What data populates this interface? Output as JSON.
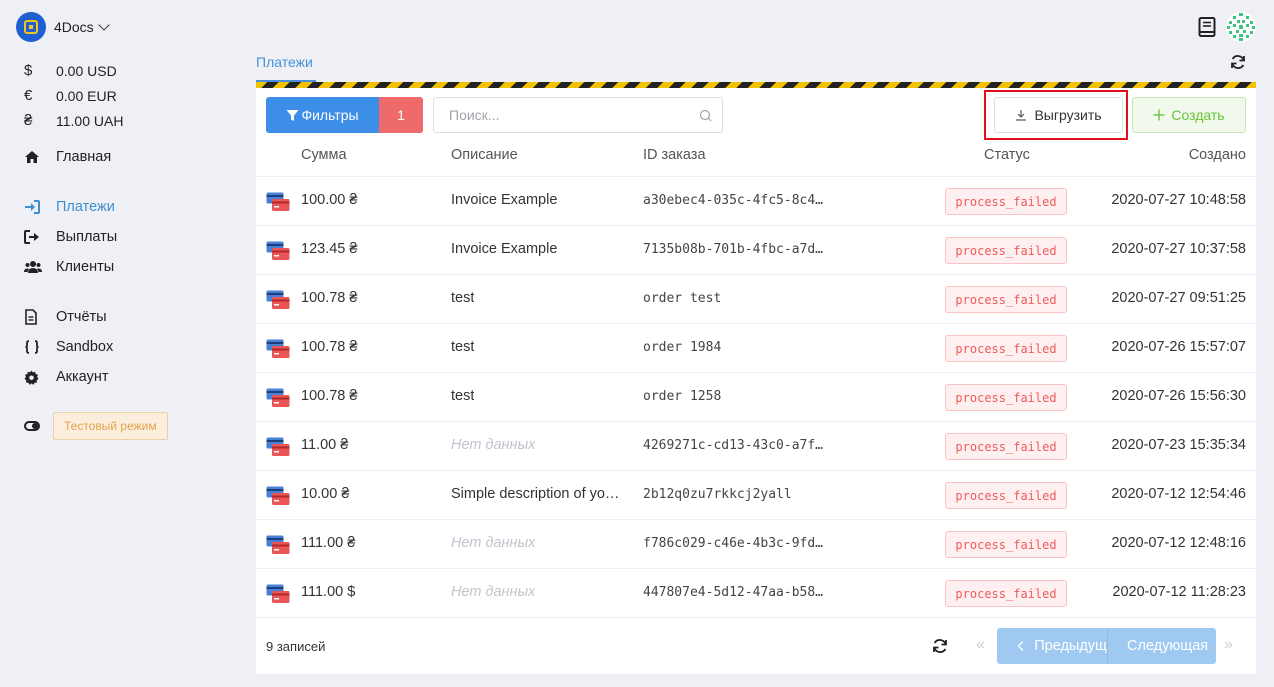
{
  "brand": {
    "name": "4Docs"
  },
  "balances": [
    {
      "symbol": "$",
      "amount": "0.00 USD"
    },
    {
      "symbol": "€",
      "amount": "0.00 EUR"
    },
    {
      "symbol": "₴",
      "amount": "11.00 UAH"
    }
  ],
  "nav": {
    "home": "Главная",
    "payments": "Платежи",
    "payouts": "Выплаты",
    "clients": "Клиенты",
    "reports": "Отчёты",
    "sandbox": "Sandbox",
    "account": "Аккаунт"
  },
  "test_mode": {
    "label": "Тестовый режим"
  },
  "tabs": {
    "payments": "Платежи"
  },
  "toolbar": {
    "filters_label": "Фильтры",
    "filters_count": "1",
    "search_placeholder": "Поиск...",
    "export_label": "Выгрузить",
    "create_label": "Создать"
  },
  "table": {
    "headers": {
      "amount": "Сумма",
      "description": "Описание",
      "order_id": "ID заказа",
      "status": "Статус",
      "created": "Создано"
    },
    "rows": [
      {
        "amount": "100.00 ₴",
        "description": "Invoice Example",
        "order_id": "a30ebec4-035c-4fc5-8c4…",
        "status": "process_failed",
        "created": "2020-07-27 10:48:58"
      },
      {
        "amount": "123.45 ₴",
        "description": "Invoice Example",
        "order_id": "7135b08b-701b-4fbc-a7d…",
        "status": "process_failed",
        "created": "2020-07-27 10:37:58"
      },
      {
        "amount": "100.78 ₴",
        "description": "test",
        "order_id": "order test",
        "status": "process_failed",
        "created": "2020-07-27 09:51:25"
      },
      {
        "amount": "100.78 ₴",
        "description": "test",
        "order_id": "order 1984",
        "status": "process_failed",
        "created": "2020-07-26 15:57:07"
      },
      {
        "amount": "100.78 ₴",
        "description": "test",
        "order_id": "order 1258",
        "status": "process_failed",
        "created": "2020-07-26 15:56:30"
      },
      {
        "amount": "11.00 ₴",
        "description": "Нет данных",
        "empty": true,
        "order_id": "4269271c-cd13-43c0-a7f…",
        "status": "process_failed",
        "created": "2020-07-23 15:35:34"
      },
      {
        "amount": "10.00 ₴",
        "description": "Simple description of yo…",
        "order_id": "2b12q0zu7rkkcj2yall",
        "status": "process_failed",
        "created": "2020-07-12 12:54:46"
      },
      {
        "amount": "111.00 ₴",
        "description": "Нет данных",
        "empty": true,
        "order_id": "f786c029-c46e-4b3c-9fd…",
        "status": "process_failed",
        "created": "2020-07-12 12:48:16"
      },
      {
        "amount": "111.00 $",
        "description": "Нет данных",
        "empty": true,
        "order_id": "447807e4-5d12-47aa-b58…",
        "status": "process_failed",
        "created": "2020-07-12 11:28:23"
      }
    ]
  },
  "footer": {
    "records": "9 записей",
    "prev_label": "Предыдущ",
    "next_label": "Следующая"
  },
  "colors": {
    "primary": "#3d8ee6",
    "danger": "#ef6a6a",
    "success": "#67c23a",
    "highlight": "#e0101a"
  }
}
